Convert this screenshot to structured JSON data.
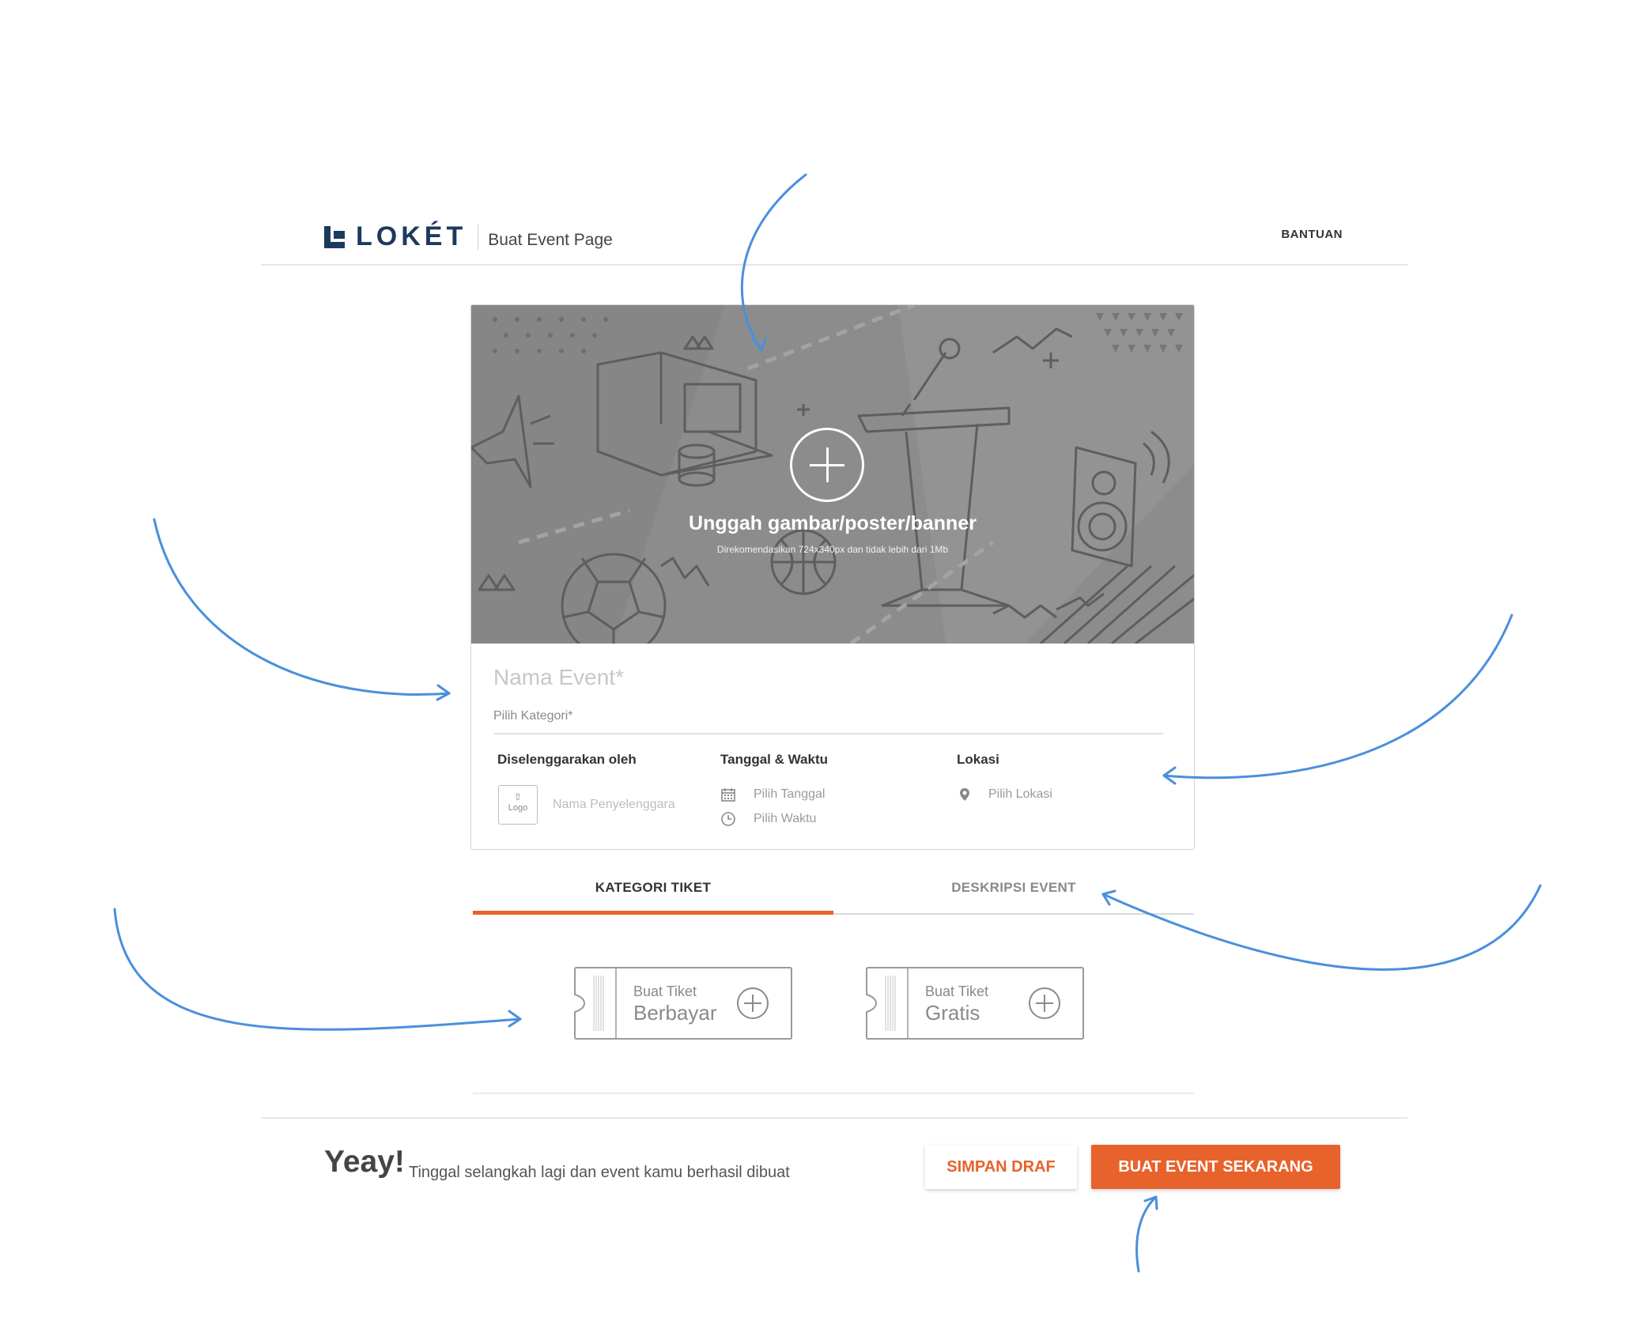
{
  "header": {
    "brand": "LOKÉT",
    "page_name": "Buat Event Page",
    "help_label": "BANTUAN"
  },
  "banner": {
    "upload_title": "Unggah gambar/poster/banner",
    "upload_hint": "Direkomendasikan 724x340px dan tidak lebih dari 1Mb"
  },
  "form": {
    "event_name_placeholder": "Nama Event*",
    "category_placeholder": "Pilih Kategori*",
    "organizer": {
      "title": "Diselenggarakan oleh",
      "logo_label": "Logo",
      "name_placeholder": "Nama Penyelenggara"
    },
    "datetime": {
      "title": "Tanggal & Waktu",
      "date_placeholder": "Pilih Tanggal",
      "time_placeholder": "Pilih Waktu"
    },
    "location": {
      "title": "Lokasi",
      "placeholder": "Pilih Lokasi"
    }
  },
  "tabs": [
    {
      "label": "KATEGORI TIKET",
      "active": true
    },
    {
      "label": "DESKRIPSI EVENT",
      "active": false
    }
  ],
  "tickets": [
    {
      "small": "Buat Tiket",
      "big": "Berbayar"
    },
    {
      "small": "Buat Tiket",
      "big": "Gratis"
    }
  ],
  "footer": {
    "headline": "Yeay!",
    "message": "Tinggal selangkah lagi dan event kamu berhasil dibuat",
    "draft_label": "SIMPAN DRAF",
    "create_label": "BUAT EVENT SEKARANG"
  },
  "colors": {
    "accent": "#e8622b",
    "brand": "#1c3a5e",
    "annotation_arrow": "#4a8fdc"
  }
}
